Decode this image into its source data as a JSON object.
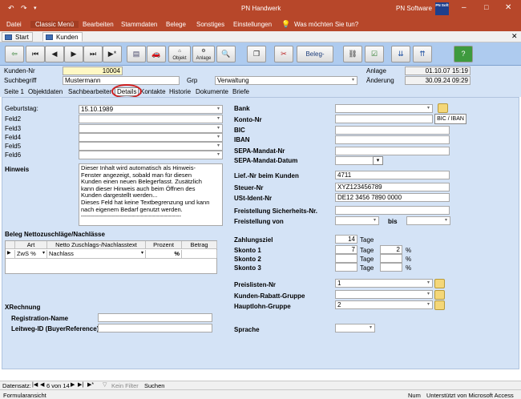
{
  "titlebar": {
    "title": "PN Handwerk",
    "right_label": "PN Software",
    "brand": "PN Soft"
  },
  "ribbon": {
    "items": [
      "Datei",
      "Classic Menü",
      "Bearbeiten",
      "Stammdaten",
      "Belege",
      "Sonstiges",
      "Einstellungen"
    ],
    "search": "Was möchten Sie tun?"
  },
  "doctabs": [
    "Start",
    "Kunden"
  ],
  "toolbar": {
    "objekt": "Objekt",
    "anlage": "Anlage",
    "beleg_listen": "Beleg-Listen"
  },
  "header": {
    "kunden_nr_label": "Kunden-Nr",
    "kunden_nr": "10004",
    "suchbegriff_label": "Suchbegriff",
    "suchbegriff": "Mustermann",
    "grp_label": "Grp",
    "grp": "Verwaltung",
    "anlage_label": "Anlage",
    "anlage": "01.10.07 15:19",
    "aenderung_label": "Änderung",
    "aenderung": "30.09.24 09:29"
  },
  "subtabs": [
    "Seite 1",
    "Objektdaten",
    "Sachbearbeiter",
    "Details",
    "Kontakte",
    "Historie",
    "Dokumente",
    "Briefe"
  ],
  "left": {
    "geburtstag_label": "Geburtstag:",
    "geburtstag": "15.10.1989",
    "felder": [
      "Feld2",
      "Feld3",
      "Feld4",
      "Feld5",
      "Feld6"
    ],
    "hinweis_label": "Hinweis",
    "hinweis_text": "Dieser Inhalt wird automatisch als Hinweis-\nFenster angezeigt, sobald man für diesen\nKunden einen neuen Belegerfasst. Zusätzlich\nkann dieser Hinweis auch beim Öffnen des\nKunden dargestellt werden...\nDieses Feld hat keine Textbegrenzung und kann\nnach eigenem Bedarf genutzt werden.\n--------------------------------------------------",
    "beleg_label": "Beleg Nettozuschläge/Nachlässe",
    "grid_headers": [
      "Art",
      "Netto Zuschlags-/Nachlasstext",
      "Prozent",
      "Betrag"
    ],
    "grid_row": {
      "art": "ZwS %",
      "text": "Nachlass",
      "prozent": "%"
    },
    "xrechnung_label": "XRechnung",
    "registration_label": "Registration-Name",
    "leitweg_label": "Leitweg-ID (BuyerReference)"
  },
  "right": {
    "bank_label": "Bank",
    "konto_label": "Konto-Nr",
    "bic_iban_button": "BIC / IBAN",
    "bic_label": "BIC",
    "iban_label": "IBAN",
    "sepa_nr_label": "SEPA-Mandat-Nr",
    "sepa_datum_label": "SEPA-Mandat-Datum",
    "lief_label": "Lief.-Nr beim Kunden",
    "lief": "4711",
    "steuer_label": "Steuer-Nr",
    "steuer": "XYZ123456789",
    "ust_label": "USt-Ident-Nr",
    "ust": "DE12 3456 7890 0000",
    "freistellung_sich_label": "Freistellung Sicherheits-Nr.",
    "freistellung_von_label": "Freistellung von",
    "bis_label": "bis",
    "zahlungsziel_label": "Zahlungsziel",
    "zahlungsziel": "14",
    "tage": "Tage",
    "skonto1_label": "Skonto 1",
    "skonto1_tage": "7",
    "skonto1_pct": "2",
    "pct": "%",
    "skonto2_label": "Skonto 2",
    "skonto3_label": "Skonto 3",
    "preislisten_label": "Preislisten-Nr",
    "preislisten": "1",
    "rabatt_label": "Kunden-Rabatt-Gruppe",
    "hauptlohn_label": "Hauptlohn-Gruppe",
    "hauptlohn": "2",
    "sprache_label": "Sprache"
  },
  "navbar": {
    "datensatz": "Datensatz:",
    "position": "6 von 14",
    "filter": "Kein Filter",
    "search": "Suchen"
  },
  "status": {
    "left": "Formularansicht",
    "num": "Num",
    "right": "Unterstützt von Microsoft Access"
  },
  "colors": {
    "accent": "#b7472a",
    "panel": "#d4e3f6",
    "toolbar": "#aecbef",
    "yellow_field": "#fff8c4"
  }
}
